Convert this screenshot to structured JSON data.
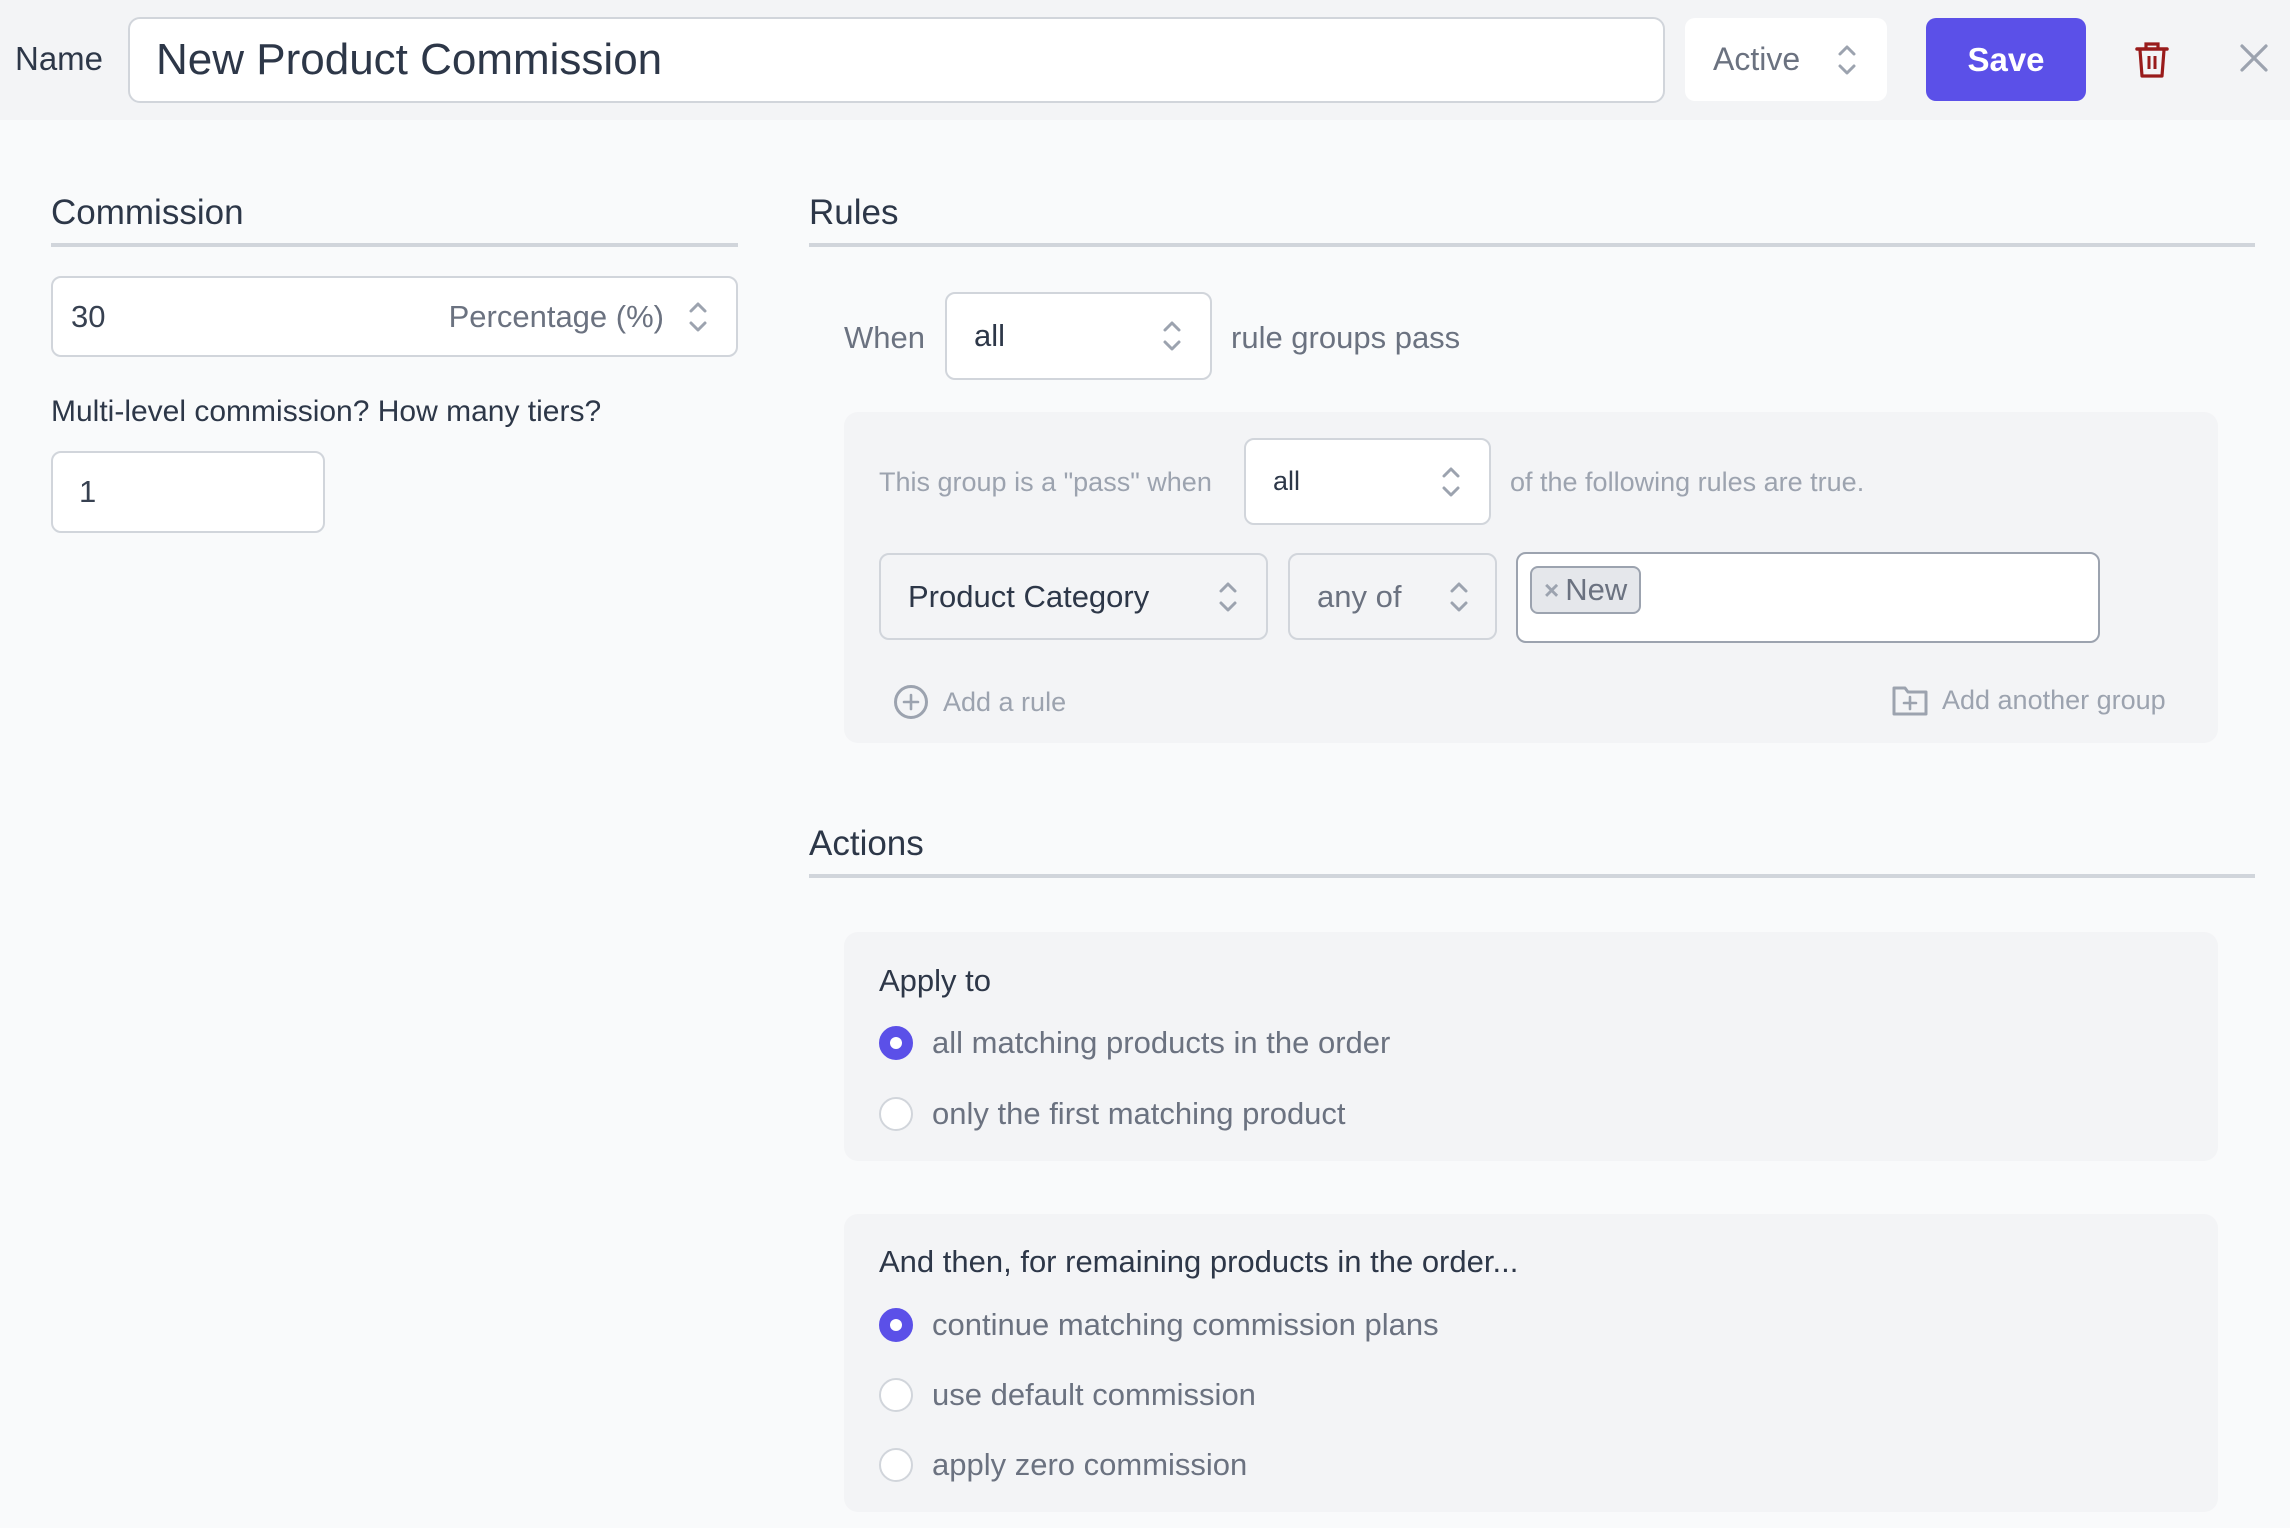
{
  "header": {
    "name_label": "Name",
    "name_value": "New Product Commission",
    "status_value": "Active",
    "save_label": "Save",
    "delete_icon": "trash-icon",
    "close_icon": "close-icon"
  },
  "commission": {
    "title": "Commission",
    "amount": "30",
    "type_value": "Percentage (%)",
    "tiers_label": "Multi-level commission? How many tiers?",
    "tiers_value": "1"
  },
  "rules": {
    "title": "Rules",
    "when_label": "When",
    "when_value": "all",
    "when_suffix": "rule groups pass",
    "group": {
      "prefix": "This group is a \"pass\" when",
      "match_value": "all",
      "suffix": "of the following rules are true.",
      "rule": {
        "field_value": "Product Category",
        "operator_value": "any of",
        "tags": [
          "New"
        ]
      },
      "add_rule_label": "Add a rule",
      "add_group_label": "Add another group"
    }
  },
  "actions": {
    "title": "Actions",
    "apply_to": {
      "title": "Apply to",
      "options": [
        {
          "label": "all matching products in the order",
          "checked": true
        },
        {
          "label": "only the first matching product",
          "checked": false
        }
      ]
    },
    "then": {
      "title": "And then, for remaining products in the order...",
      "options": [
        {
          "label": "continue matching commission plans",
          "checked": true
        },
        {
          "label": "use default commission",
          "checked": false
        },
        {
          "label": "apply zero commission",
          "checked": false
        }
      ]
    }
  },
  "colors": {
    "accent": "#5b50e8",
    "danger": "#991b1b",
    "background": "#f9fafb",
    "header_bg": "#f3f4f6"
  }
}
